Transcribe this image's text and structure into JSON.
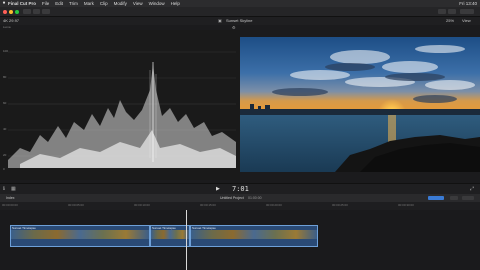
{
  "menubar": {
    "apple": "",
    "items": [
      "Final Cut Pro",
      "File",
      "Edit",
      "Trim",
      "Mark",
      "Clip",
      "Modify",
      "View",
      "Window",
      "Help"
    ],
    "right": [
      "Fri 13:40"
    ]
  },
  "browser": {
    "left_label": "4K 29.97",
    "viewer_title": "Sunset Skyline",
    "zoom": "25%",
    "view": "View"
  },
  "scope": {
    "title": "Luma",
    "scale": [
      "100",
      "80",
      "60",
      "40",
      "20",
      "0"
    ]
  },
  "transport": {
    "timecode": "7:01"
  },
  "timeline": {
    "index": "Index",
    "project": "Untitled Project",
    "duration": "01:00:00",
    "ruler": [
      "00:00:00:00",
      "00:00:05:00",
      "00:00:10:00",
      "00:00:15:00",
      "00:00:20:00",
      "00:00:25:00",
      "00:00:30:00"
    ],
    "clips": [
      "Sunset Timelapse",
      "Sunset Timelapse",
      "Sunset Timelapse"
    ]
  },
  "colors": {
    "accent": "#3a7bd5",
    "clip": "#2a4a75"
  }
}
